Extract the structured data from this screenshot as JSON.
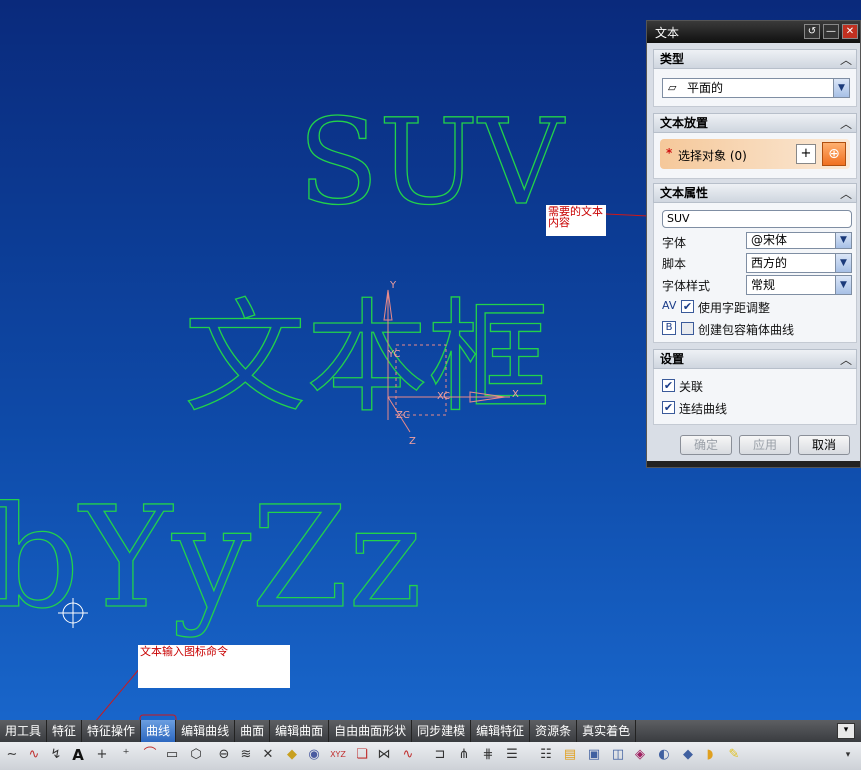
{
  "scene": {
    "text_suv": "SUV",
    "text_box": "文本框",
    "text_letters": "bYyZz",
    "axis_y": "Y",
    "axis_yc": "YC",
    "axis_x": "X",
    "axis_xc": "XC",
    "axis_z": "Z",
    "axis_zc": "ZC",
    "colors": {
      "outline": "#22d24a",
      "background": "#0e4aa8",
      "axis": "#e88a8a"
    }
  },
  "callouts": {
    "text_content": "需要的文本内容",
    "text_icon": "文本输入图标命令"
  },
  "dialog": {
    "title": "文本",
    "type": {
      "header": "类型",
      "value": "平面的"
    },
    "placement": {
      "header": "文本放置",
      "label": "选择对象 (0)"
    },
    "properties": {
      "header": "文本属性",
      "text_value": "SUV",
      "font_label": "字体",
      "font_value": "@宋体",
      "script_label": "脚本",
      "script_value": "西方的",
      "style_label": "字体样式",
      "style_value": "常规",
      "kerning_label": "使用字距调整",
      "box_label": "创建包容箱体曲线"
    },
    "settings": {
      "header": "设置",
      "associative_label": "关联",
      "chain_label": "连结曲线"
    },
    "buttons": {
      "ok": "确定",
      "apply": "应用",
      "cancel": "取消"
    }
  },
  "menubar": {
    "tabs": [
      "用工具",
      "特征",
      "特征操作",
      "曲线",
      "编辑曲线",
      "曲面",
      "编辑曲面",
      "自由曲面形状",
      "同步建模",
      "编辑特征",
      "资源条",
      "真实着色"
    ],
    "active": "曲线"
  }
}
